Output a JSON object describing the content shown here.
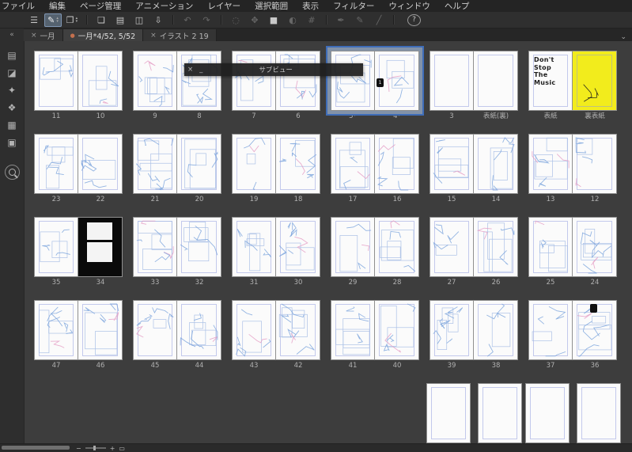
{
  "menubar": {
    "items": [
      "ファイル",
      "編集",
      "ページ管理",
      "アニメーション",
      "レイヤー",
      "選択範囲",
      "表示",
      "フィルター",
      "ウィンドウ",
      "ヘルプ"
    ]
  },
  "toolbar": {
    "stepper_up": "▴",
    "stepper_down": "▾",
    "buttons": [
      {
        "name": "main-menu",
        "glyph": "☰"
      },
      {
        "name": "page-edit-tool",
        "glyph": "✎",
        "active": true,
        "stepper": true
      },
      {
        "name": "story-info-tool",
        "glyph": "❐",
        "stepper": true
      },
      {
        "type": "sep"
      },
      {
        "name": "new-page",
        "glyph": "❏"
      },
      {
        "name": "open-file",
        "glyph": "▤"
      },
      {
        "name": "save-file",
        "glyph": "◫"
      },
      {
        "name": "export-file",
        "glyph": "⇩"
      },
      {
        "type": "sep"
      },
      {
        "name": "undo",
        "glyph": "↶",
        "disabled": true
      },
      {
        "name": "redo",
        "glyph": "↷",
        "disabled": true
      },
      {
        "type": "sep"
      },
      {
        "name": "selection-tool",
        "glyph": "◌",
        "disabled": true
      },
      {
        "name": "transform-tool",
        "glyph": "✥",
        "disabled": true
      },
      {
        "name": "fill-tool",
        "glyph": "■"
      },
      {
        "name": "gradient-tool",
        "glyph": "◐",
        "disabled": true
      },
      {
        "name": "frame-border-tool",
        "glyph": "#",
        "disabled": true
      },
      {
        "type": "sep"
      },
      {
        "name": "pen-tool",
        "glyph": "✒",
        "disabled": true
      },
      {
        "name": "pencil-tool",
        "glyph": "✎",
        "disabled": true
      },
      {
        "name": "ruler-tool",
        "glyph": "╱",
        "disabled": true
      },
      {
        "type": "sep"
      },
      {
        "name": "help",
        "glyph": "?",
        "circle": true
      }
    ]
  },
  "tabs": {
    "chevron": "⌄",
    "items": [
      {
        "close": "×",
        "label": "一月"
      },
      {
        "dot": "●",
        "label": "一月*4/52, 5/52",
        "active": true
      },
      {
        "close": "×",
        "label": "イラスト 2 19"
      }
    ]
  },
  "sidebar": {
    "collapse_icon": "«",
    "icons": [
      {
        "name": "navigator-panel",
        "glyph": "▤"
      },
      {
        "name": "material-panel",
        "glyph": "◪"
      },
      {
        "name": "material-color-panel",
        "glyph": "✦"
      },
      {
        "name": "material-pattern-panel",
        "glyph": "❖"
      },
      {
        "name": "material-tone-panel",
        "glyph": "▦"
      },
      {
        "name": "material-image-panel",
        "glyph": "▣"
      },
      {
        "name": "search-panel",
        "magnifier": true
      }
    ]
  },
  "subview": {
    "title": "サブビュー",
    "close_icon": "×",
    "minimize_icon": "_"
  },
  "cover": {
    "lines": [
      "Don't",
      "Stop",
      "The",
      "Music"
    ]
  },
  "statusbar": {
    "zoom_out": "−",
    "zoom_in": "+",
    "fit_icon": "▭"
  },
  "grid": {
    "rows": [
      {
        "cells": [
          {
            "pages": [
              {
                "label": "11"
              },
              {
                "label": "10"
              }
            ]
          },
          {
            "pages": [
              {
                "label": "9"
              },
              {
                "label": "8"
              }
            ]
          },
          {
            "pages": [
              {
                "label": "7"
              },
              {
                "label": "6"
              }
            ]
          },
          {
            "selected": true,
            "pages": [
              {
                "label": "5*"
              },
              {
                "label": "4*",
                "badge": "1",
                "badge_pos": "cl"
              }
            ]
          },
          {
            "pages": [
              {
                "label": "3",
                "blank": true
              },
              {
                "label": "表紙(裏)",
                "blank": true
              }
            ]
          },
          {
            "pages": [
              {
                "label": "表紙",
                "style": "cover"
              },
              {
                "label": "裏表紙",
                "style": "yellow"
              }
            ]
          }
        ]
      },
      {
        "cells": [
          {
            "pages": [
              {
                "label": "23"
              },
              {
                "label": "22"
              }
            ]
          },
          {
            "pages": [
              {
                "label": "21"
              },
              {
                "label": "20"
              }
            ]
          },
          {
            "pages": [
              {
                "label": "19"
              },
              {
                "label": "18"
              }
            ]
          },
          {
            "pages": [
              {
                "label": "17"
              },
              {
                "label": "16"
              }
            ]
          },
          {
            "pages": [
              {
                "label": "15"
              },
              {
                "label": "14"
              }
            ]
          },
          {
            "pages": [
              {
                "label": "13"
              },
              {
                "label": "12"
              }
            ]
          }
        ]
      },
      {
        "cells": [
          {
            "pages": [
              {
                "label": "35"
              },
              {
                "label": "34",
                "style": "black"
              }
            ]
          },
          {
            "pages": [
              {
                "label": "33"
              },
              {
                "label": "32"
              }
            ]
          },
          {
            "pages": [
              {
                "label": "31"
              },
              {
                "label": "30"
              }
            ]
          },
          {
            "pages": [
              {
                "label": "29"
              },
              {
                "label": "28"
              }
            ]
          },
          {
            "pages": [
              {
                "label": "27"
              },
              {
                "label": "26"
              }
            ]
          },
          {
            "pages": [
              {
                "label": "25"
              },
              {
                "label": "24"
              }
            ]
          }
        ]
      },
      {
        "cells": [
          {
            "pages": [
              {
                "label": "47"
              },
              {
                "label": "46"
              }
            ]
          },
          {
            "pages": [
              {
                "label": "45"
              },
              {
                "label": "44"
              }
            ]
          },
          {
            "pages": [
              {
                "label": "43"
              },
              {
                "label": "42"
              }
            ]
          },
          {
            "pages": [
              {
                "label": "41"
              },
              {
                "label": "40"
              }
            ]
          },
          {
            "pages": [
              {
                "label": "39"
              },
              {
                "label": "38"
              }
            ]
          },
          {
            "pages": [
              {
                "label": "37"
              },
              {
                "label": "36",
                "badge": true,
                "badge_pos": "top"
              }
            ]
          }
        ]
      },
      {
        "cells": [
          null,
          null,
          null,
          null,
          {
            "gap": true,
            "pages": [
              {
                "label": "",
                "blank": true
              },
              {
                "label": "",
                "blank": true
              }
            ]
          },
          {
            "gap": true,
            "pages": [
              {
                "label": "",
                "blank": true
              },
              {
                "label": "",
                "blank": true
              }
            ]
          }
        ]
      }
    ]
  }
}
